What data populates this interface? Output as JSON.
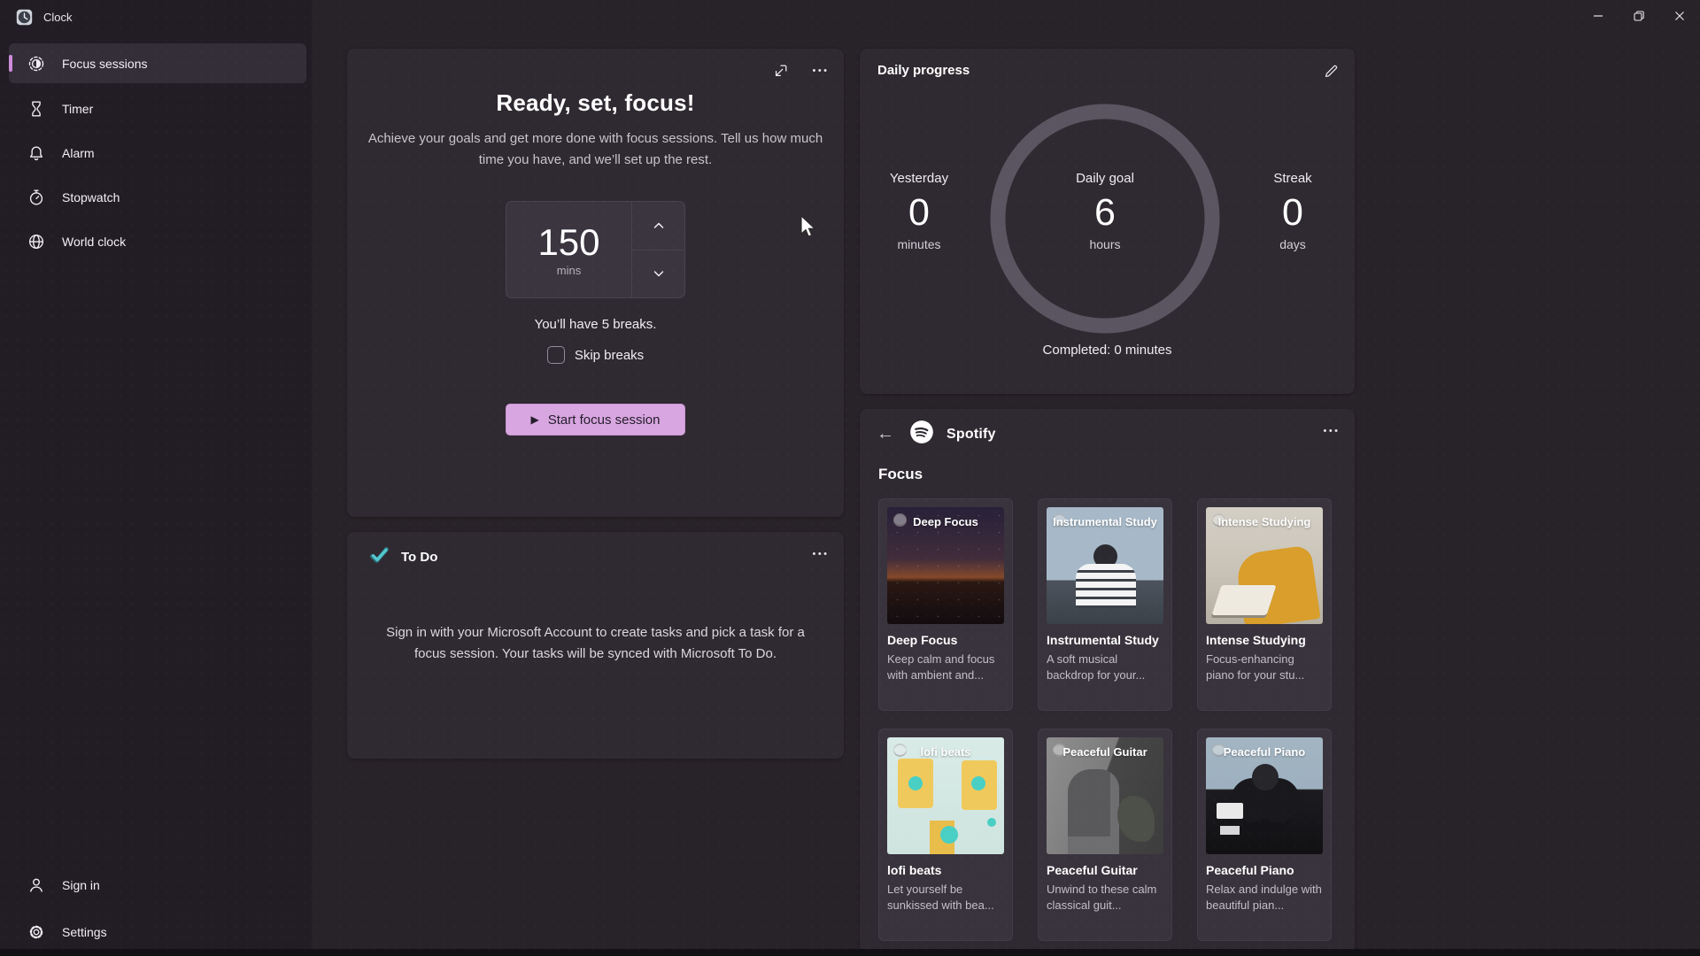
{
  "window": {
    "title": "Clock"
  },
  "icons": {
    "more": "•••",
    "back": "←",
    "play": "▶"
  },
  "sidebar": {
    "items": [
      {
        "label": "Focus sessions",
        "selected": true
      },
      {
        "label": "Timer"
      },
      {
        "label": "Alarm"
      },
      {
        "label": "Stopwatch"
      },
      {
        "label": "World clock"
      }
    ],
    "footer": [
      {
        "label": "Sign in"
      },
      {
        "label": "Settings"
      }
    ]
  },
  "focus_card": {
    "title": "Ready, set, focus!",
    "subtitle": "Achieve your goals and get more done with focus sessions. Tell us how much time you have, and we’ll set up the rest.",
    "duration": {
      "value": "150",
      "unit": "mins"
    },
    "breaks_note": "You’ll have 5 breaks.",
    "skip_breaks_label": "Skip breaks",
    "start_button": "Start focus session"
  },
  "todo_card": {
    "title": "To Do",
    "body": "Sign in with your Microsoft Account to create tasks and pick a task for a focus session. Your tasks will be synced with Microsoft To Do."
  },
  "daily_progress": {
    "title": "Daily progress",
    "stats": [
      {
        "label": "Yesterday",
        "value": "0",
        "unit": "minutes"
      },
      {
        "label": "Daily goal",
        "value": "6",
        "unit": "hours"
      },
      {
        "label": "Streak",
        "value": "0",
        "unit": "days"
      }
    ],
    "completed": "Completed: 0 minutes"
  },
  "spotify": {
    "brand": "Spotify",
    "section": "Focus",
    "playlists": [
      {
        "title": "Deep Focus",
        "desc": "Keep calm and focus with ambient and...",
        "art": "Deep Focus"
      },
      {
        "title": "Instrumental Study",
        "desc": "A soft musical backdrop for your...",
        "art": "Instrumental Study"
      },
      {
        "title": "Intense Studying",
        "desc": "Focus-enhancing piano for your stu...",
        "art": "Intense Studying"
      },
      {
        "title": "lofi beats",
        "desc": "Let yourself be sunkissed with bea...",
        "art": "lofi beats"
      },
      {
        "title": "Peaceful Guitar",
        "desc": "Unwind to these calm classical guit...",
        "art": "Peaceful Guitar"
      },
      {
        "title": "Peaceful Piano",
        "desc": "Relax and indulge with beautiful pian...",
        "art": "Peaceful Piano"
      }
    ]
  },
  "colors": {
    "accent_button": "#d8a6e0",
    "selection_bar": "#ce8ddb",
    "ring": "#5a5560",
    "sidebar_bg": "#221d24",
    "content_bg": "#282229",
    "card_bg": "#2f2931"
  }
}
